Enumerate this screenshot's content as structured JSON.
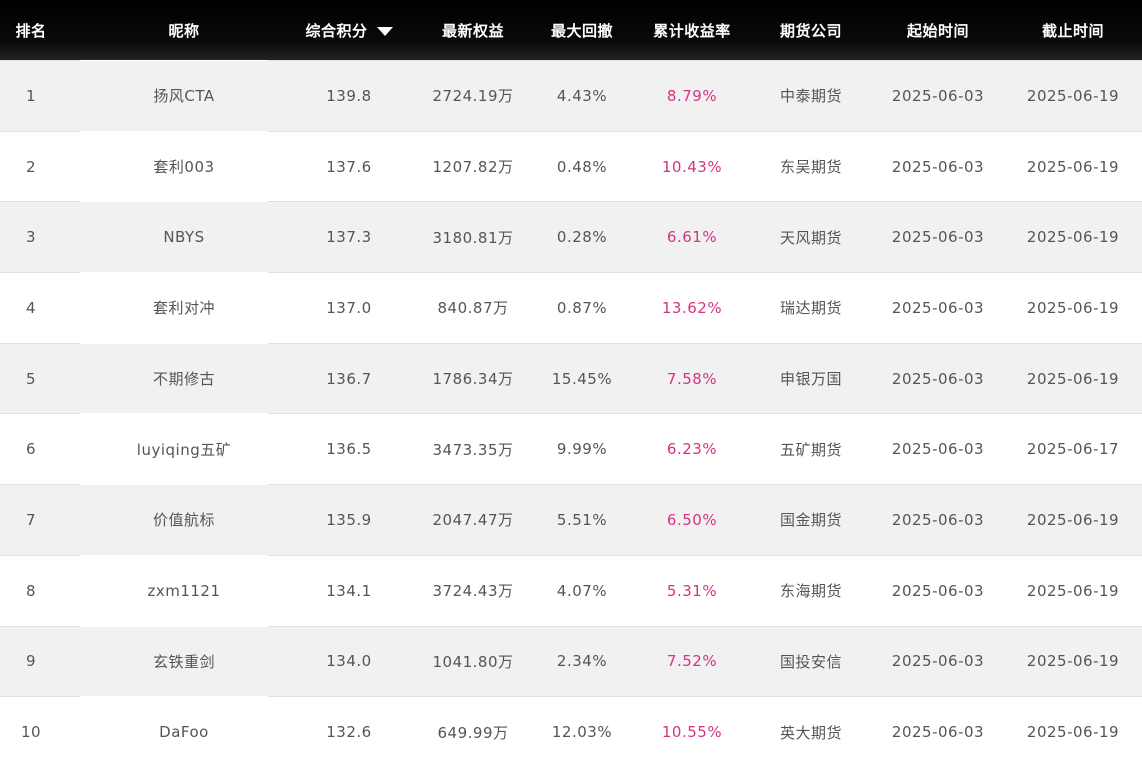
{
  "columns": {
    "rank": "排名",
    "name": "昵称",
    "score": "综合积分",
    "equity": "最新权益",
    "drawdown": "最大回撤",
    "return": "累计收益率",
    "company": "期货公司",
    "start": "起始时间",
    "end": "截止时间"
  },
  "sort_icon": "triangle-down",
  "colors": {
    "header_bg": "#000000",
    "row_alt_bg": "#f1f1f1",
    "return_text": "#d63384",
    "body_text": "#555555"
  },
  "rows": [
    {
      "rank": "1",
      "name": "扬风CTA",
      "score": "139.8",
      "equity": "2724.19万",
      "drawdown": "4.43%",
      "return": "8.79%",
      "company": "中泰期货",
      "start": "2025-06-03",
      "end": "2025-06-19"
    },
    {
      "rank": "2",
      "name": "套利003",
      "score": "137.6",
      "equity": "1207.82万",
      "drawdown": "0.48%",
      "return": "10.43%",
      "company": "东吴期货",
      "start": "2025-06-03",
      "end": "2025-06-19"
    },
    {
      "rank": "3",
      "name": "NBYS",
      "score": "137.3",
      "equity": "3180.81万",
      "drawdown": "0.28%",
      "return": "6.61%",
      "company": "天风期货",
      "start": "2025-06-03",
      "end": "2025-06-19"
    },
    {
      "rank": "4",
      "name": "套利对冲",
      "score": "137.0",
      "equity": "840.87万",
      "drawdown": "0.87%",
      "return": "13.62%",
      "company": "瑞达期货",
      "start": "2025-06-03",
      "end": "2025-06-19"
    },
    {
      "rank": "5",
      "name": "不期修古",
      "score": "136.7",
      "equity": "1786.34万",
      "drawdown": "15.45%",
      "return": "7.58%",
      "company": "申银万国",
      "start": "2025-06-03",
      "end": "2025-06-19"
    },
    {
      "rank": "6",
      "name": "luyiqing五矿",
      "score": "136.5",
      "equity": "3473.35万",
      "drawdown": "9.99%",
      "return": "6.23%",
      "company": "五矿期货",
      "start": "2025-06-03",
      "end": "2025-06-17"
    },
    {
      "rank": "7",
      "name": "价值航标",
      "score": "135.9",
      "equity": "2047.47万",
      "drawdown": "5.51%",
      "return": "6.50%",
      "company": "国金期货",
      "start": "2025-06-03",
      "end": "2025-06-19"
    },
    {
      "rank": "8",
      "name": "zxm1121",
      "score": "134.1",
      "equity": "3724.43万",
      "drawdown": "4.07%",
      "return": "5.31%",
      "company": "东海期货",
      "start": "2025-06-03",
      "end": "2025-06-19"
    },
    {
      "rank": "9",
      "name": "玄铁重剑",
      "score": "134.0",
      "equity": "1041.80万",
      "drawdown": "2.34%",
      "return": "7.52%",
      "company": "国投安信",
      "start": "2025-06-03",
      "end": "2025-06-19"
    },
    {
      "rank": "10",
      "name": "DaFoo",
      "score": "132.6",
      "equity": "649.99万",
      "drawdown": "12.03%",
      "return": "10.55%",
      "company": "英大期货",
      "start": "2025-06-03",
      "end": "2025-06-19"
    }
  ]
}
